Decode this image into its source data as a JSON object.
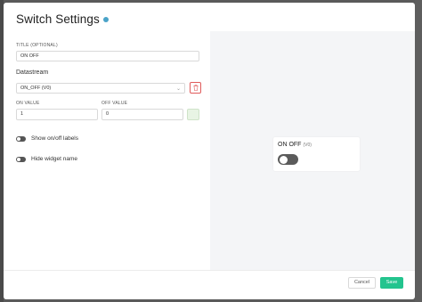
{
  "modal": {
    "title": "Switch Settings"
  },
  "form": {
    "title_label": "TITLE (OPTIONAL)",
    "title_value": "ON OFF",
    "datastream_label": "Datastream",
    "datastream_value": "ON_OFF (V0)",
    "on_value_label": "ON VALUE",
    "on_value": "1",
    "off_value_label": "OFF VALUE",
    "off_value": "0",
    "color_swatch": "#e8f4e4",
    "show_labels_text": "Show on/off labels",
    "hide_name_text": "Hide widget name"
  },
  "preview": {
    "widget_title": "ON OFF",
    "widget_datastream": "(V0)"
  },
  "footer": {
    "cancel_label": "Cancel",
    "save_label": "Save"
  },
  "colors": {
    "accent": "#23c48e",
    "danger": "#e05a5a",
    "info": "#4aa3c8"
  }
}
